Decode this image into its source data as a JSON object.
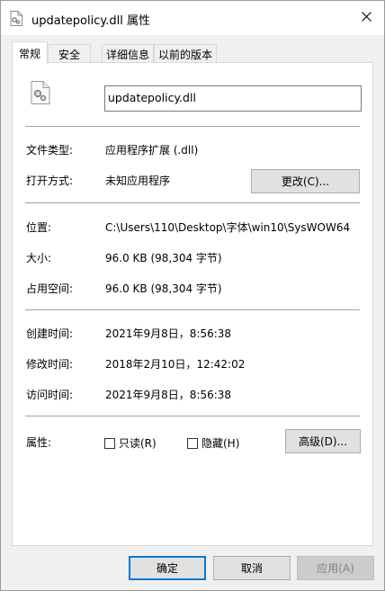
{
  "window": {
    "title": "updatepolicy.dll 属性",
    "title_icon": "dll-file-icon",
    "close_icon": "close-icon"
  },
  "tabs": [
    {
      "label": "常规",
      "active": true
    },
    {
      "label": "安全",
      "active": false
    },
    {
      "label": "详细信息",
      "active": false
    },
    {
      "label": "以前的版本",
      "active": false
    }
  ],
  "general": {
    "file_icon": "dll-gear-file-icon",
    "file_name": "updatepolicy.dll",
    "file_type_label": "文件类型:",
    "file_type_value": "应用程序扩展 (.dll)",
    "opens_with_label": "打开方式:",
    "opens_with_value": "未知应用程序",
    "change_button": "更改(C)...",
    "location_label": "位置:",
    "location_value": "C:\\Users\\110\\Desktop\\字体\\win10\\SysWOW64",
    "size_label": "大小:",
    "size_value": "96.0 KB (98,304 字节)",
    "size_on_disk_label": "占用空间:",
    "size_on_disk_value": "96.0 KB (98,304 字节)",
    "created_label": "创建时间:",
    "created_value": "2021年9月8日，8:56:38",
    "modified_label": "修改时间:",
    "modified_value": "2018年2月10日，12:42:02",
    "accessed_label": "访问时间:",
    "accessed_value": "2021年9月8日，8:56:38",
    "attributes_label": "属性:",
    "readonly_label": "只读(R)",
    "readonly_checked": false,
    "hidden_label": "隐藏(H)",
    "hidden_checked": false,
    "advanced_button": "高级(D)..."
  },
  "footer": {
    "ok_button": "确定",
    "cancel_button": "取消",
    "apply_button": "应用(A)"
  },
  "colors": {
    "focus_border": "#0078d7",
    "button_face": "#e1e1e1",
    "disabled_face": "#cccccc"
  }
}
